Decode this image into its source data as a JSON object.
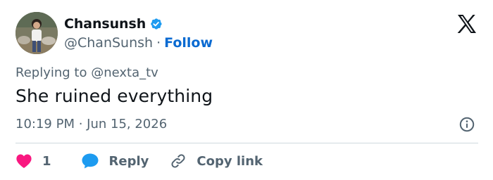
{
  "author": {
    "display_name": "Chansunsh",
    "handle": "@ChanSunsh",
    "separator": "·",
    "follow_label": "Follow",
    "verified": true
  },
  "reply_context": {
    "prefix": "Replying to",
    "mention": "@nexta_tv"
  },
  "tweet": {
    "text": "She ruined everything",
    "timestamp": "10:19 PM · Jun 15, 2026"
  },
  "actions": {
    "like_count": "1",
    "reply_label": "Reply",
    "copy_link_label": "Copy link"
  },
  "icons": {
    "verified": "verified-badge-icon",
    "x_logo": "x-logo-icon",
    "info": "info-icon",
    "like": "heart-icon",
    "reply": "speech-bubble-icon",
    "copy_link": "link-icon"
  },
  "colors": {
    "text_primary": "#0f1419",
    "text_secondary": "#536471",
    "link_blue": "#0a6ad1",
    "verified_blue": "#1d9bf0",
    "like_pink": "#f91880",
    "divider": "#cfd9de"
  }
}
